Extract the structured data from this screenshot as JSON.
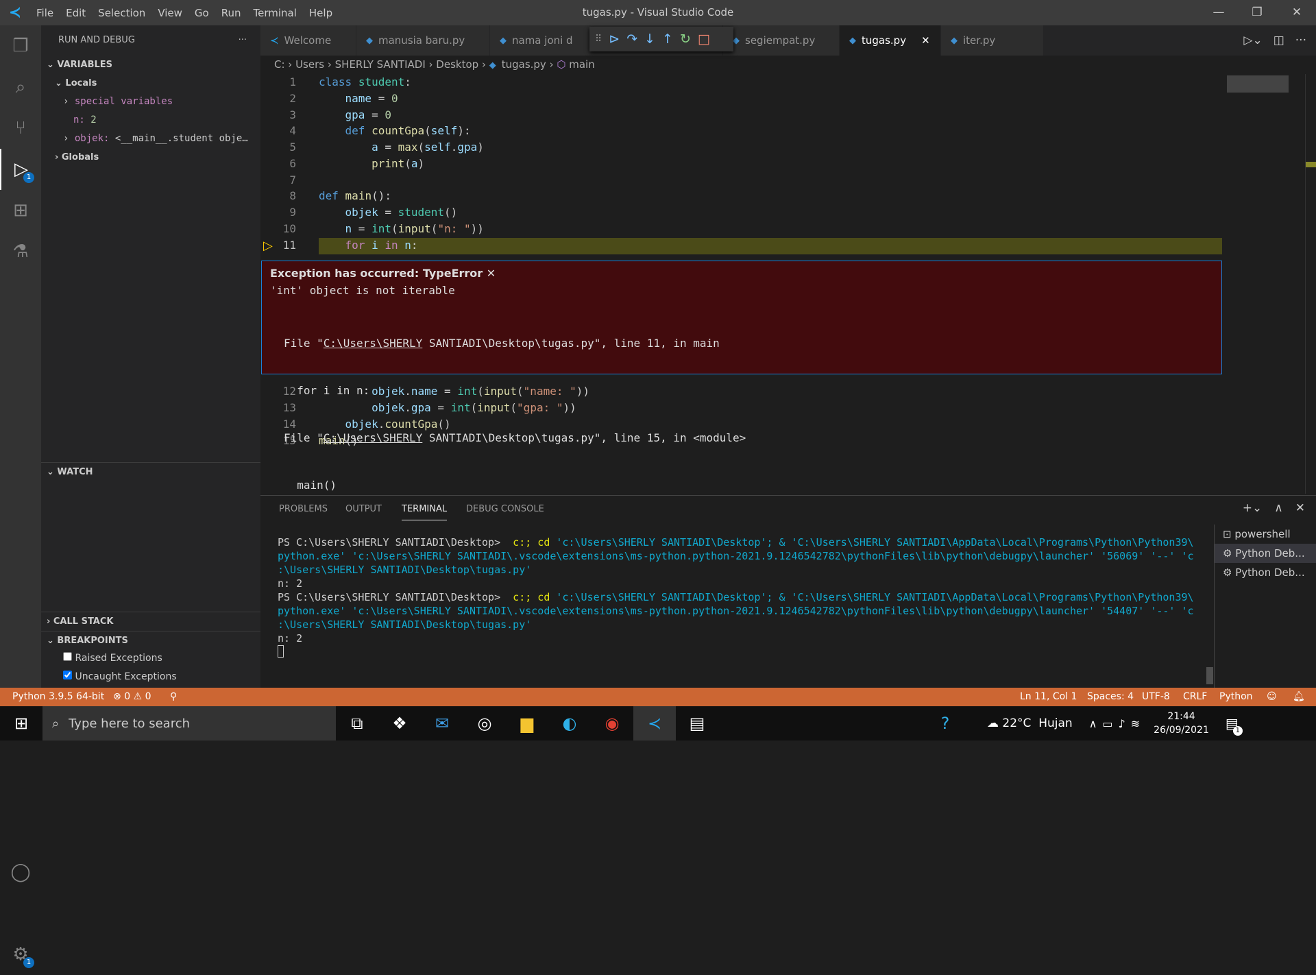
{
  "window": {
    "title": "tugas.py - Visual Studio Code",
    "menu": [
      "File",
      "Edit",
      "Selection",
      "View",
      "Go",
      "Run",
      "Terminal",
      "Help"
    ]
  },
  "activity": {
    "items": [
      "explorer-icon",
      "search-icon",
      "source-control-icon",
      "run-debug-icon",
      "extensions-icon",
      "testing-icon",
      "account-icon",
      "settings-icon"
    ],
    "debug_badge": "1",
    "settings_badge": "1"
  },
  "sidebar": {
    "title": "RUN AND DEBUG",
    "more": "···",
    "variables": "VARIABLES",
    "locals": "Locals",
    "special": "special variables",
    "n_name": "n:",
    "n_val": "2",
    "objek_name": "objek:",
    "objek_val": "<__main__.student obje…",
    "globals": "Globals",
    "watch": "WATCH",
    "callstack": "CALL STACK",
    "breakpoints": "BREAKPOINTS",
    "bp": [
      {
        "label": "Raised Exceptions",
        "checked": false
      },
      {
        "label": "Uncaught Exceptions",
        "checked": true
      }
    ]
  },
  "tabs": [
    {
      "label": "Welcome"
    },
    {
      "label": "manusia baru.py"
    },
    {
      "label": "nama joni d"
    },
    {
      "label": "segiempat.py"
    },
    {
      "label": "tugas.py",
      "active": true
    },
    {
      "label": "iter.py"
    }
  ],
  "breadcrumb": [
    "C:",
    "Users",
    "SHERLY SANTIADI",
    "Desktop",
    "tugas.py",
    "main"
  ],
  "code": {
    "lines": [
      "1",
      "2",
      "3",
      "4",
      "5",
      "6",
      "7",
      "8",
      "9",
      "10",
      "11",
      "12",
      "13",
      "14",
      "15"
    ],
    "current_line": "11"
  },
  "exception": {
    "title": "Exception has occurred: TypeError",
    "close": "✕",
    "message": "'int' object is not iterable",
    "trace": [
      "File \"",
      "C:\\Users\\SHERLY",
      " SANTIADI\\Desktop\\tugas.py\", line 11, in main",
      "  for i in n:",
      "File \"",
      "C:\\Users\\SHERLY",
      " SANTIADI\\Desktop\\tugas.py\", line 15, in <module>",
      "  main()"
    ]
  },
  "panel": {
    "tabs": [
      "PROBLEMS",
      "OUTPUT",
      "TERMINAL",
      "DEBUG CONSOLE"
    ],
    "active": "TERMINAL",
    "terminals": [
      "powershell",
      "Python Deb...",
      "Python Deb..."
    ],
    "prompt": "PS C:\\Users\\SHERLY SANTIADI\\Desktop> ",
    "cmd1": "c:; cd ",
    "cmd2": "'c:\\Users\\SHERLY SANTIADI\\Desktop'; & 'C:\\Users\\SHERLY SANTIADI\\AppData\\Local\\Programs\\Python\\Python39\\",
    "run1a": "python.exe' 'c:\\Users\\SHERLY SANTIADI\\.vscode\\extensions\\ms-python.python-2021.9.1246542782\\pythonFiles\\lib\\python\\debugpy\\launcher' '56069' '--' 'c",
    "run2a": "python.exe' 'c:\\Users\\SHERLY SANTIADI\\.vscode\\extensions\\ms-python.python-2021.9.1246542782\\pythonFiles\\lib\\python\\debugpy\\launcher' '54407' '--' 'c",
    "runb": ":\\Users\\SHERLY SANTIADI\\Desktop\\tugas.py'",
    "out": "n: 2"
  },
  "status": {
    "python": "Python 3.9.5 64-bit",
    "errors": "0",
    "warnings": "0",
    "position": "Ln 11, Col 1",
    "spaces": "Spaces: 4",
    "encoding": "UTF-8",
    "eol": "CRLF",
    "language": "Python",
    "color": "#cc6633"
  },
  "taskbar": {
    "search": "Type here to search",
    "weather": "22°C  Hujan",
    "time": "21:44",
    "date": "26/09/2021",
    "notif": "1"
  }
}
